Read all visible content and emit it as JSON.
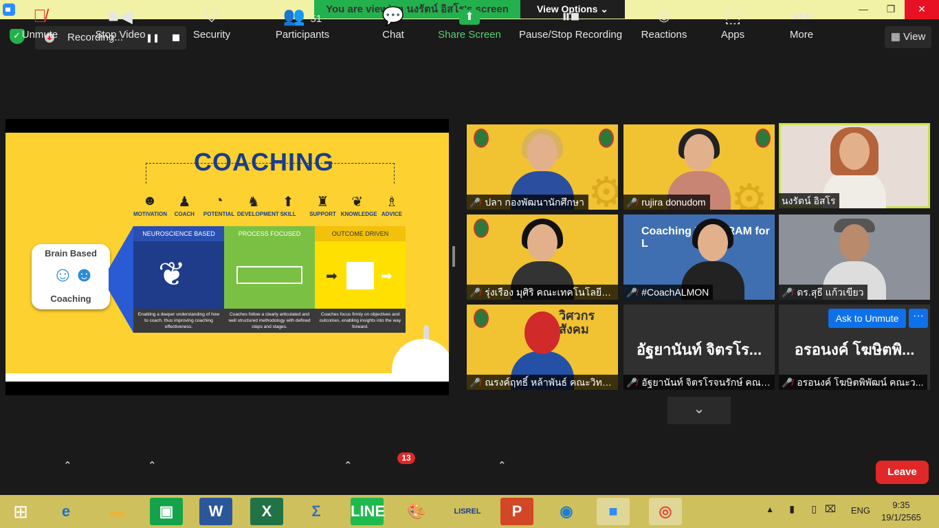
{
  "banner": {
    "viewing_text": "You  are  viewing นงรัตน์ อิสโร's screen",
    "view_options": "View Options ⌄"
  },
  "recording": {
    "label": "Recording..."
  },
  "view_button": "View",
  "slide": {
    "title": "COACHING",
    "icons": [
      "MOTIVATION",
      "COACH",
      "POTENTIAL",
      "DEVELOPMENT",
      "SKILL",
      "SUPPORT",
      "KNOWLEDGE",
      "ADVICE"
    ],
    "brain_top": "Brain Based",
    "brain_bottom": "Coaching",
    "columns": [
      {
        "head": "NEUROSCIENCE BASED",
        "foot": "Enabling a deeper understanding of how to coach, thus improving coaching effectiveness."
      },
      {
        "head": "PROCESS FOCUSED",
        "foot": "Coaches follow a clearly articulated and well structured methodology with defined steps and stages."
      },
      {
        "head": "OUTCOME DRIVEN",
        "foot": "Coaches focus firmly  on objectives and outcomes, enabling insights into the way forward."
      }
    ]
  },
  "participants_tiles": [
    {
      "name": "ปลา กองพัฒนานักศึกษา",
      "muted": true,
      "type": "video"
    },
    {
      "name": "rujira donudom",
      "muted": true,
      "type": "video"
    },
    {
      "name": "นงรัตน์ อิสโร",
      "muted": false,
      "type": "video",
      "active": true
    },
    {
      "name": "รุ่งเรือง มุศิริ คณะเทคโนโลยีอุต...",
      "muted": true,
      "type": "video"
    },
    {
      "name": "#CoachALMON",
      "muted": true,
      "type": "video",
      "slide_text": "Coaching PROGRAM for L"
    },
    {
      "name": "ดร.สุธี  แก้วเขียว",
      "muted": true,
      "type": "video"
    },
    {
      "name": "ณรงค์ฤทธิ์ หล้าพันธ์ คณะวิทย...",
      "muted": true,
      "type": "video"
    },
    {
      "name": "อัฐยานันท์ จิตรโรจนรักษ์ คณะ...",
      "muted": true,
      "type": "name",
      "big": "อัฐยานันท์ จิตรโร..."
    },
    {
      "name": "อรอนงค์ โฆษิตพิพัฒน์ คณะว...",
      "muted": true,
      "type": "name",
      "big": "อรอนงค์ โฆษิตพิ..."
    }
  ],
  "sign_text": "วิศวกร\nสังคม",
  "ask_unmute": "Ask to Unmute",
  "more_dots": "···",
  "toolbar": {
    "unmute": "Unmute",
    "stop_video": "Stop Video",
    "security": "Security",
    "participants": "Participants",
    "participants_count": "51",
    "chat": "Chat",
    "chat_badge": "13",
    "share_screen": "Share Screen",
    "pause_stop": "Pause/Stop Recording",
    "reactions": "Reactions",
    "apps": "Apps",
    "more": "More",
    "leave": "Leave"
  },
  "taskbar": {
    "lang": "ENG",
    "time": "9:35",
    "date": "19/1/2565",
    "lisrel": "LISREL"
  },
  "colors": {
    "zoom_blue": "#0e71eb",
    "green": "#23b14d",
    "red": "#e02828",
    "highlight": "#c7e34b"
  }
}
